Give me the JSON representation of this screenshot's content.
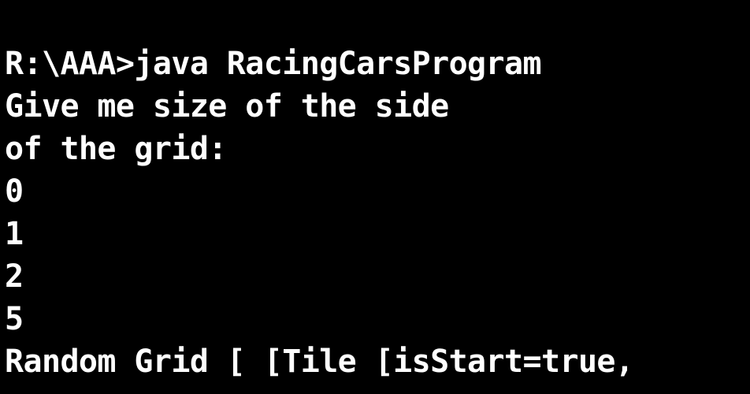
{
  "console": {
    "background": "#000000",
    "foreground": "#ffffff",
    "lines": [
      "R:\\AAA>java RacingCarsProgram",
      "Give me size of the side",
      "of the grid:",
      "0",
      "1",
      "2",
      "5",
      "Random Grid [ [Tile [isStart=true,"
    ]
  }
}
